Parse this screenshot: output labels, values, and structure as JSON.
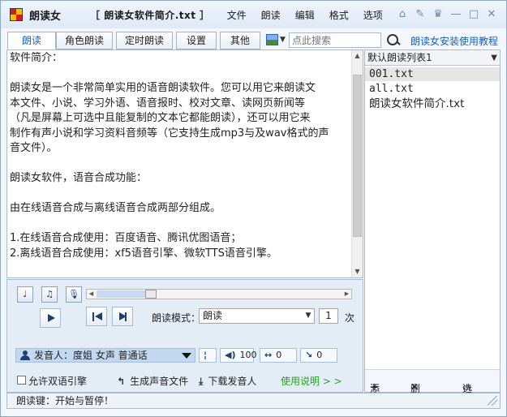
{
  "app": {
    "name": "朗读女",
    "doc_title": "［ 朗读女软件简介.txt ］"
  },
  "menus": [
    "文件",
    "朗读",
    "编辑",
    "格式",
    "选项"
  ],
  "title_controls": [
    "home-icon",
    "pin-icon",
    "skin-icon",
    "minimize-icon",
    "maximize-icon",
    "close-icon"
  ],
  "tabs": [
    "朗读",
    "角色朗读",
    "定时朗读",
    "设置",
    "其他"
  ],
  "active_tab": "朗读",
  "search": {
    "placeholder": "点此搜索"
  },
  "help_link": "朗读女安装使用教程",
  "document": {
    "lines": [
      "软件简介：",
      "",
      "朗读女是一个非常简单实用的语音朗读软件。您可以用它来朗读文",
      "本文件、小说、学习外语、语音报时、校对文章、读网页新闻等",
      "（凡是屏幕上可选中且能复制的文本它都能朗读），还可以用它来",
      "制作有声小说和学习资料音频等（它支持生成mp3与及wav格式的声",
      "音文件）。",
      "",
      "朗读女软件，语音合成功能：",
      "",
      "由在线语音合成与离线语音合成两部分组成。",
      "",
      "1.在线语音合成使用：百度语音、腾讯优图语音；",
      "2.离线语音合成使用：xf5语音引擎、微软TTS语音引擎。"
    ]
  },
  "controls": {
    "progress": 0.2,
    "mode_label": "朗读模式：",
    "mode_value": "朗读",
    "repeat_count": "1",
    "repeat_unit": "次",
    "speaker": "发音人：度姐 女声 普通话",
    "volume": "100",
    "speed": "0",
    "pitch": "0",
    "bilingual_label": "允许双语引擎",
    "bilingual_checked": false,
    "generate_audio": "生成声音文件",
    "download_speaker": "下载发音人",
    "usage_link": "使用说明 > >"
  },
  "playlist": {
    "name": "默认朗读列表1",
    "items": [
      "001.txt",
      "all.txt",
      "朗读女软件简介.txt"
    ],
    "selected_index": 0,
    "add_label": "添加",
    "delete_label": "删除",
    "options_label": "选项"
  },
  "status": "朗读键：开始与暂停！"
}
